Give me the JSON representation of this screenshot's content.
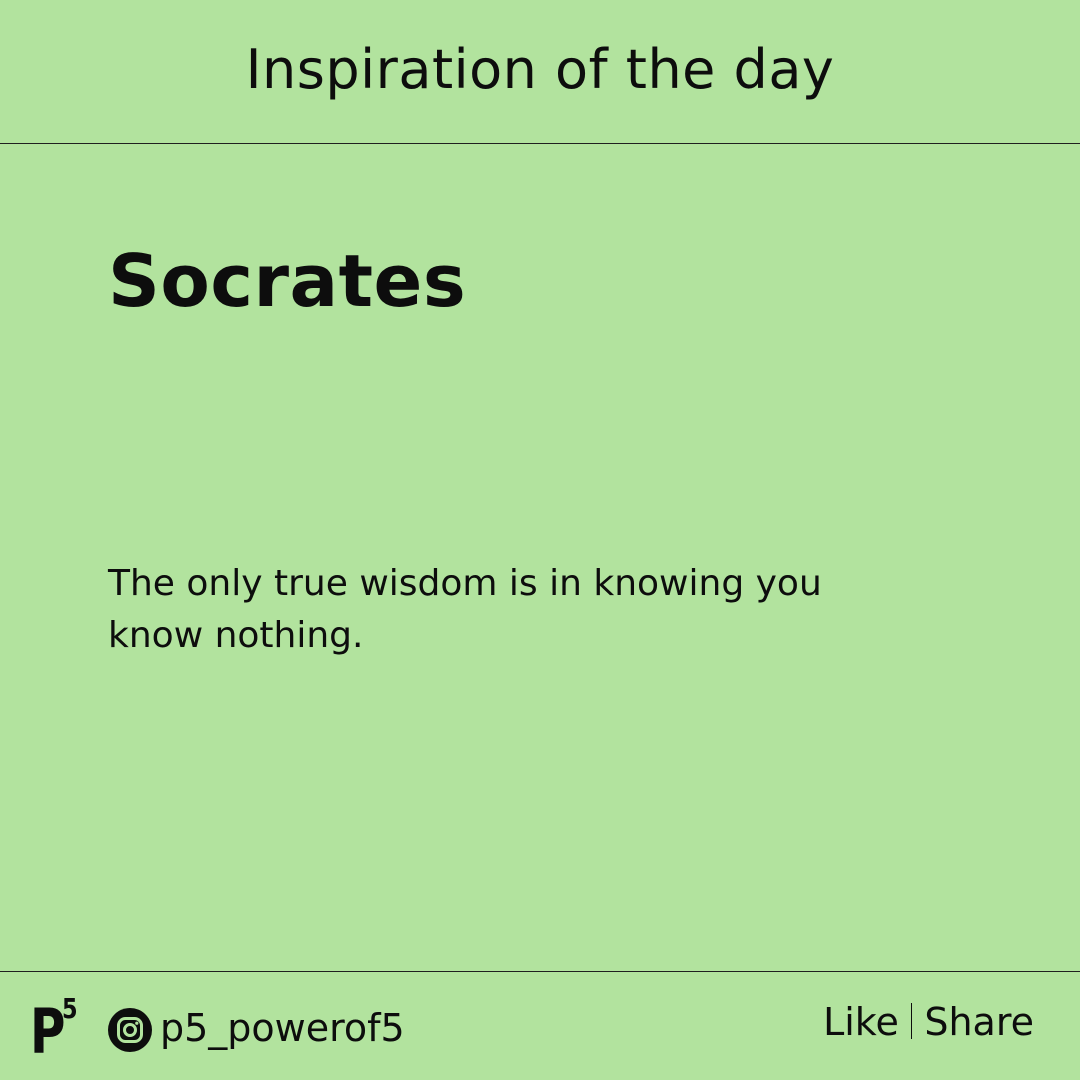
{
  "header": {
    "title": "Inspiration of the day"
  },
  "author": "Socrates",
  "quote": "The only true wisdom is in knowing you know nothing.",
  "footer": {
    "logo_letter": "P",
    "logo_superscript": "5",
    "handle_icon": "instagram-icon",
    "handle": "p5_powerof5",
    "like_label": "Like",
    "separator": "|",
    "share_label": "Share"
  },
  "colors": {
    "background": "#b2e39e",
    "text": "#0d0d0d"
  }
}
